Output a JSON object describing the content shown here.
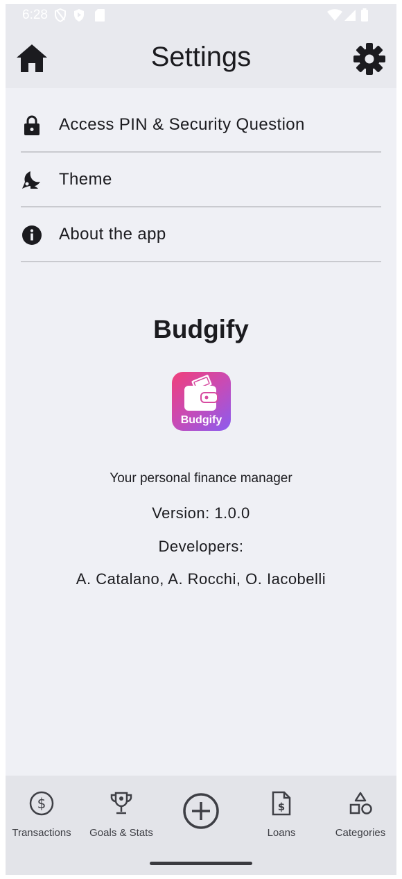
{
  "status_bar": {
    "time": "6:28",
    "icons": [
      "shield-outline-icon",
      "shield-play-icon",
      "sd-card-icon",
      "wifi-icon",
      "signal-icon",
      "battery-icon"
    ]
  },
  "app_bar": {
    "title": "Settings",
    "left_icon": "home-icon",
    "right_icon": "gear-icon"
  },
  "settings_items": [
    {
      "label": "Access PIN & Security Question",
      "icon": "lock-icon"
    },
    {
      "label": "Theme",
      "icon": "theme-moon-icon"
    },
    {
      "label": "About the app",
      "icon": "info-icon"
    }
  ],
  "about": {
    "app_name": "Budgify",
    "logo_text": "Budgify",
    "tagline": "Your personal finance manager",
    "version": "Version: 1.0.0",
    "developers_label": "Developers:",
    "developers": "A. Catalano, A. Rocchi, O. Iacobelli"
  },
  "bottom_nav": {
    "items": [
      {
        "label": "Transactions",
        "icon": "dollar-circle-icon"
      },
      {
        "label": "Goals & Stats",
        "icon": "trophy-icon"
      },
      {
        "label": "",
        "icon": "add-circle-icon"
      },
      {
        "label": "Loans",
        "icon": "loan-document-icon"
      },
      {
        "label": "Categories",
        "icon": "shapes-icon"
      }
    ]
  },
  "colors": {
    "background": "#eff0f5",
    "app_bar": "#e8e9ee",
    "nav_bar": "#e3e4e9",
    "divider": "#c9cacf",
    "logo_gradient_start": "#f0407a",
    "logo_gradient_end": "#8a5cf0"
  }
}
